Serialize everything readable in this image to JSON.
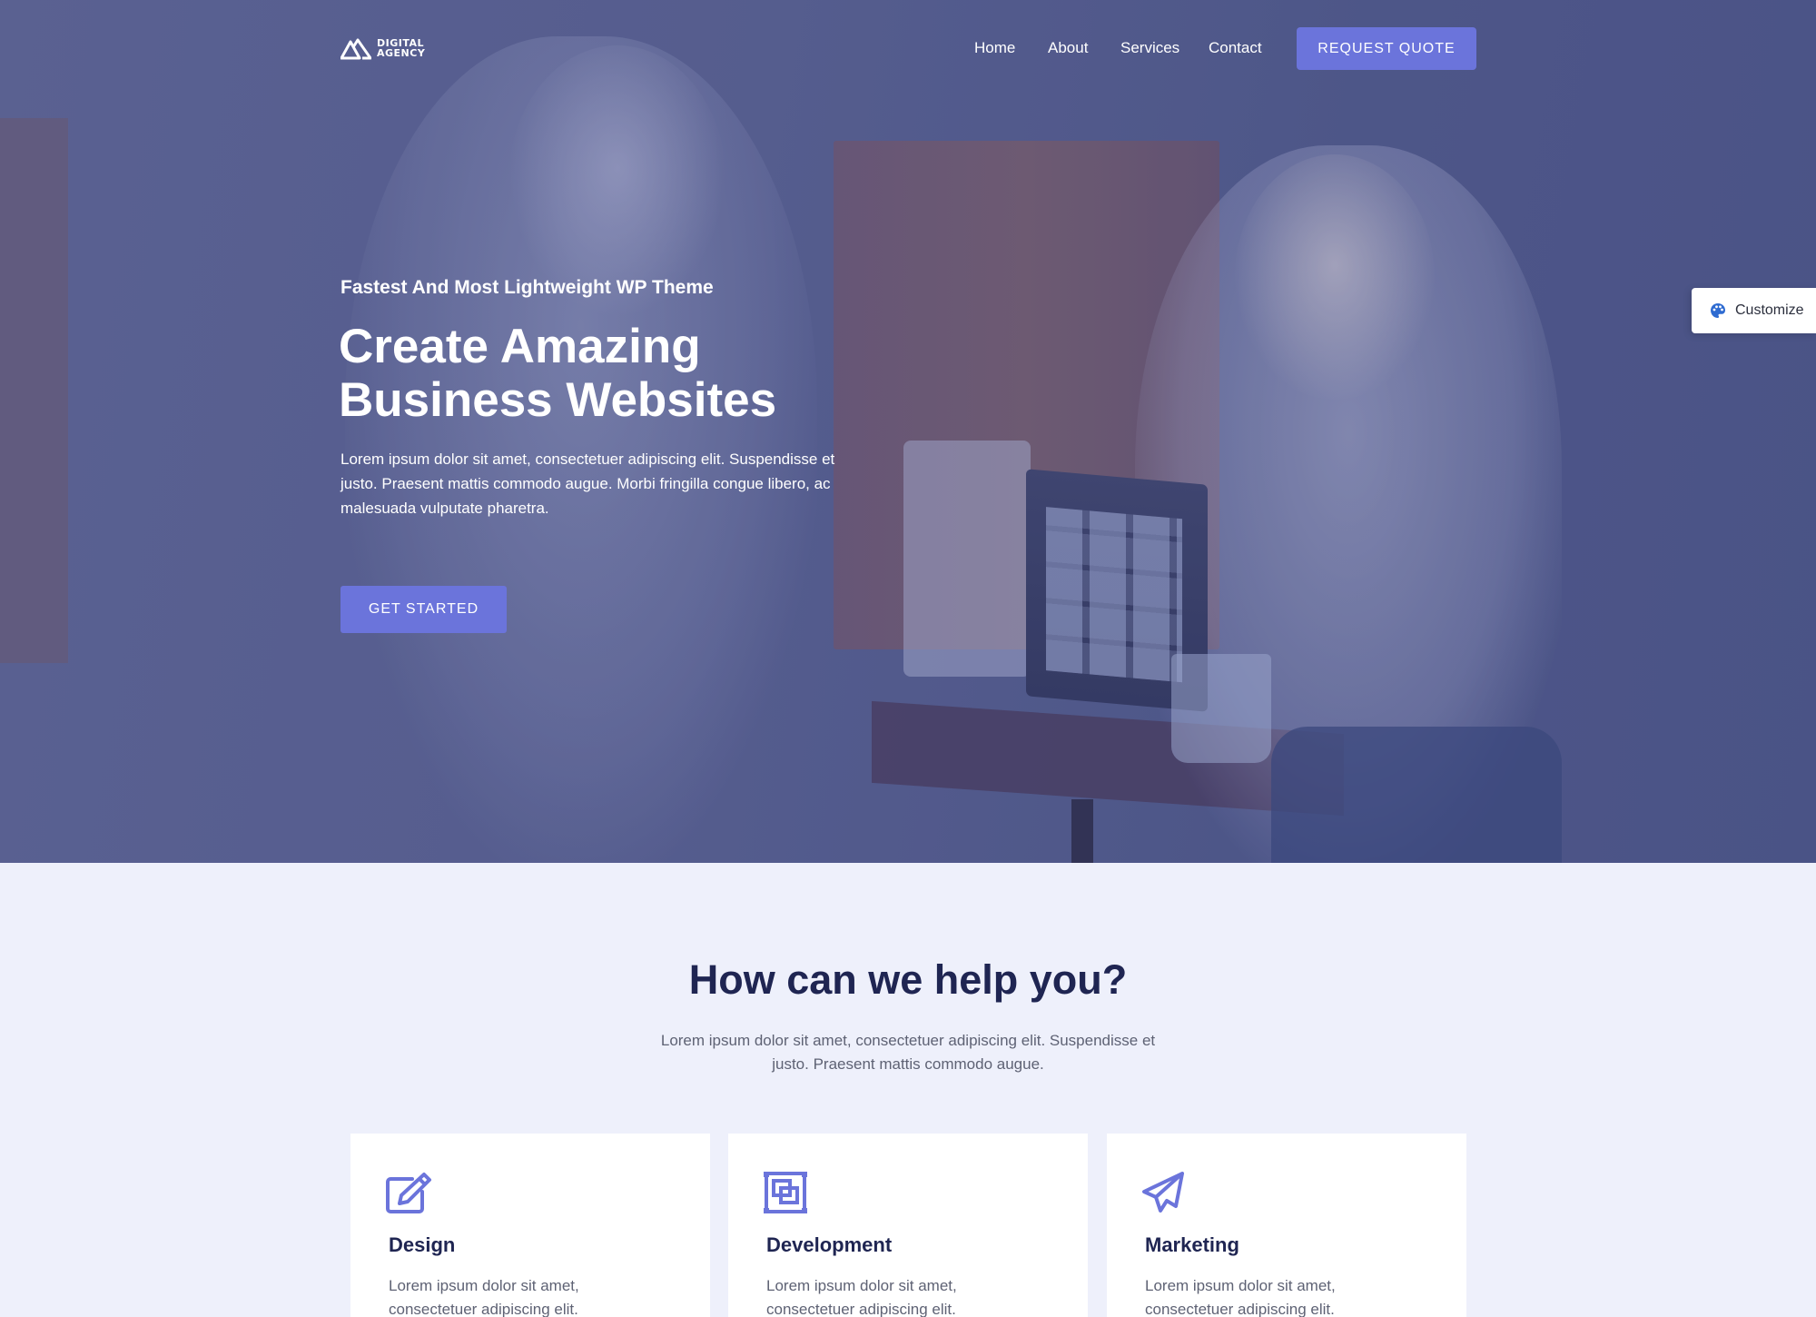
{
  "brand": {
    "logo_line1": "DIGITAL",
    "logo_line2": "AGENCY"
  },
  "nav": {
    "items": [
      {
        "label": "Home"
      },
      {
        "label": "About"
      },
      {
        "label": "Services"
      },
      {
        "label": "Contact"
      }
    ],
    "cta_label": "REQUEST QUOTE"
  },
  "hero": {
    "tagline": "Fastest And Most Lightweight WP Theme",
    "headline": "Create Amazing Business Websites",
    "intro": "Lorem ipsum dolor sit amet, consectetuer adipiscing elit. Suspendisse et justo. Praesent mattis commodo augue. Morbi fringilla congue libero, ac malesuada vulputate pharetra.",
    "cta_label": "GET STARTED"
  },
  "customize": {
    "label": "Customize",
    "icon": "palette-icon"
  },
  "help": {
    "title": "How can we help you?",
    "subtitle": "Lorem ipsum dolor sit amet, consectetuer adipiscing elit. Suspendisse et justo. Praesent mattis commodo augue.",
    "cards": [
      {
        "title": "Design",
        "icon": "edit-icon",
        "text": "Lorem ipsum dolor sit amet, consectetuer adipiscing elit."
      },
      {
        "title": "Development",
        "icon": "layers-icon",
        "text": "Lorem ipsum dolor sit amet, consectetuer adipiscing elit."
      },
      {
        "title": "Marketing",
        "icon": "paper-plane-icon",
        "text": "Lorem ipsum dolor sit amet, consectetuer adipiscing elit."
      }
    ]
  },
  "colors": {
    "accent": "#6b74db",
    "heading": "#1f2552",
    "section_bg": "#eef0fb"
  }
}
